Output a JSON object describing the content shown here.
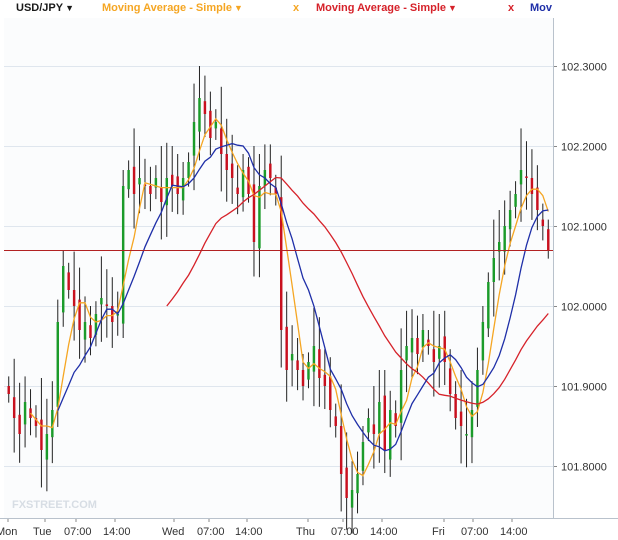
{
  "toolbar": {
    "symbol": "USD/JPY",
    "symbol_caret": "▼",
    "indicators": [
      {
        "label": "Moving Average - Simple",
        "caret": "▼",
        "close": "x",
        "color": "#f5a623"
      },
      {
        "label": "Moving Average - Simple",
        "caret": "▼",
        "close": "x",
        "color": "#d6222a"
      },
      {
        "label": "Mov",
        "color": "#1f2fa8"
      }
    ]
  },
  "watermark": "FXSTREET.COM",
  "colors": {
    "bull": "#1b9b2a",
    "bear": "#c8101e",
    "wick": "#222222",
    "ma_fast": "#f5a623",
    "ma_slow": "#d6222a",
    "ma_mid": "#1f2fa8",
    "grid": "#dfe6ee",
    "hline": "#b22222"
  },
  "chart_data": {
    "type": "candlestick",
    "instrument": "USD/JPY",
    "x_ticks": [
      "Mon",
      "Tue",
      "07:00",
      "14:00",
      "Wed",
      "07:00",
      "14:00",
      "Thu",
      "07:00",
      "14:00",
      "Fri",
      "07:00",
      "14:00"
    ],
    "y_ticks": [
      "102.3000",
      "102.2000",
      "102.1000",
      "102.0000",
      "101.9000",
      "101.8000"
    ],
    "ylim": [
      101.735,
      102.36
    ],
    "horizontal_line": 102.07,
    "grid": true,
    "closes": [
      101.89,
      101.86,
      101.84,
      101.88,
      101.86,
      101.85,
      101.82,
      101.84,
      101.87,
      101.98,
      102.05,
      102.02,
      102.0,
      101.97,
      101.98,
      101.96,
      101.99,
      102.01,
      102.0,
      101.98,
      101.99,
      102.15,
      102.17,
      102.14,
      102.16,
      102.15,
      102.14,
      102.16,
      102.13,
      102.16,
      102.15,
      102.14,
      102.16,
      102.18,
      102.23,
      102.26,
      102.24,
      102.21,
      102.23,
      102.19,
      102.17,
      102.16,
      102.14,
      102.17,
      102.14,
      102.08,
      102.15,
      102.17,
      102.16,
      102.14,
      101.97,
      101.92,
      101.94,
      101.92,
      101.9,
      101.93,
      101.95,
      101.91,
      101.9,
      101.87,
      101.85,
      101.79,
      101.76,
      101.77,
      101.79,
      101.83,
      101.86,
      101.84,
      101.88,
      101.82,
      101.87,
      101.85,
      101.92,
      101.95,
      101.96,
      101.94,
      101.97,
      101.95,
      101.93,
      101.95,
      101.93,
      101.89,
      101.86,
      101.85,
      101.84,
      101.87,
      101.92,
      101.98,
      102.03,
      102.06,
      102.08,
      102.1,
      102.12,
      102.14,
      102.17,
      102.16,
      102.14,
      102.12,
      102.1,
      102.07
    ],
    "moving_averages": [
      {
        "name": "Moving Average - Simple",
        "period": 5,
        "color": "#f5a623"
      },
      {
        "name": "Moving Average - Simple",
        "period": 30,
        "color": "#d6222a"
      },
      {
        "name": "Mov",
        "period": 10,
        "color": "#1f2fa8"
      }
    ]
  }
}
